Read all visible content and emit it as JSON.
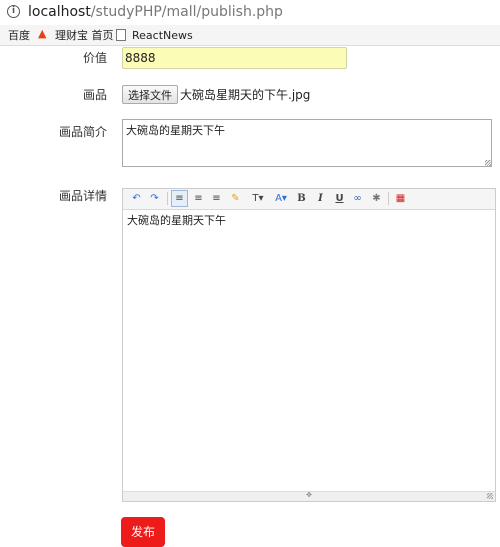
{
  "browser": {
    "url_host": "localhost",
    "url_path": "/studyPHP/mall/publish.php",
    "bookmarks": [
      "百度",
      "理财宝 首页",
      "ReactNews"
    ],
    "icons": [
      "info-icon",
      "flame-icon",
      "document-icon"
    ]
  },
  "form": {
    "value_label": "价值",
    "value": "8888",
    "painting_label": "画品",
    "choose_file_label": "选择文件",
    "file_name": "大碗岛星期天的下午.jpg",
    "brief_label": "画品简介",
    "brief_text": "大碗岛的星期天下午",
    "detail_label": "画品详情",
    "detail_text": "大碗岛的星期天下午",
    "submit_label": "发布",
    "colors": {
      "value_bg": "#fbfcb6",
      "submit_bg": "#ee1b1b"
    }
  },
  "editor_toolbar": [
    "undo-icon",
    "redo-icon",
    "align-left-icon",
    "align-center-icon",
    "align-right-icon",
    "highlight-icon",
    "font-size-icon",
    "font-color-icon",
    "bold-icon",
    "italic-icon",
    "underline-icon",
    "link-icon",
    "unlink-icon",
    "fullscreen-icon"
  ]
}
